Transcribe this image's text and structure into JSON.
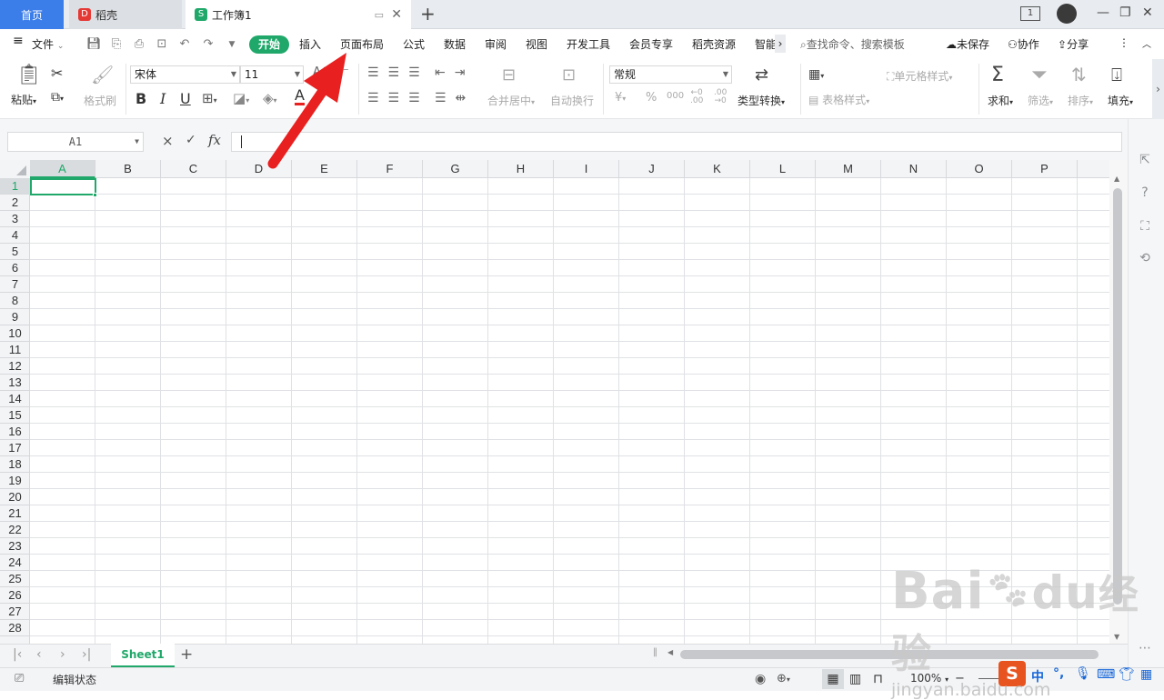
{
  "tabs": {
    "home": "首页",
    "daoke": "稻壳",
    "workbook": "工作簿1",
    "add": "+"
  },
  "window": {
    "badge": "1"
  },
  "menu": {
    "file": "文件",
    "items": [
      "开始",
      "插入",
      "页面布局",
      "公式",
      "数据",
      "审阅",
      "视图",
      "开发工具",
      "会员专享",
      "稻壳资源",
      "智能"
    ],
    "search_placeholder": "查找命令、搜索模板",
    "unsaved": "未保存",
    "collab": "协作",
    "share": "分享"
  },
  "ribbon": {
    "paste": "粘贴",
    "format_painter": "格式刷",
    "font_name": "宋体",
    "font_size": "11",
    "bold": "B",
    "italic": "I",
    "underline": "U",
    "font_color": "A",
    "merge_center": "合并居中",
    "wrap_text": "自动换行",
    "number_format": "常规",
    "percent": "%",
    "thousands": "000",
    "type_convert": "类型转换",
    "cell_style": "单元格样式",
    "table_style": "表格样式",
    "sum": "求和",
    "filter": "筛选",
    "sort": "排序",
    "fill": "填充"
  },
  "formula_bar": {
    "cell_ref": "A1",
    "cancel": "×",
    "confirm": "✓",
    "fx": "fx",
    "value": ""
  },
  "grid": {
    "columns": [
      "A",
      "B",
      "C",
      "D",
      "E",
      "F",
      "G",
      "H",
      "I",
      "J",
      "K",
      "L",
      "M",
      "N",
      "O",
      "P"
    ],
    "rows": [
      "1",
      "2",
      "3",
      "4",
      "5",
      "6",
      "7",
      "8",
      "9",
      "10",
      "11",
      "12",
      "13",
      "14",
      "15",
      "16",
      "17",
      "18",
      "19",
      "20",
      "21",
      "22",
      "23",
      "24",
      "25",
      "26",
      "27",
      "28"
    ],
    "active_cell": "A1"
  },
  "sheets": {
    "names": [
      "Sheet1"
    ],
    "add": "+"
  },
  "status": {
    "mode": "编辑状态",
    "zoom": "100%",
    "ime_lang": "中"
  },
  "watermark": {
    "brand": "Bai",
    "brand2": "经验",
    "url": "jingyan.baidu.com"
  },
  "colors": {
    "accent_green": "#20a86a",
    "home_tab_blue": "#3b7de9",
    "annotation_arrow": "#e8201f"
  }
}
